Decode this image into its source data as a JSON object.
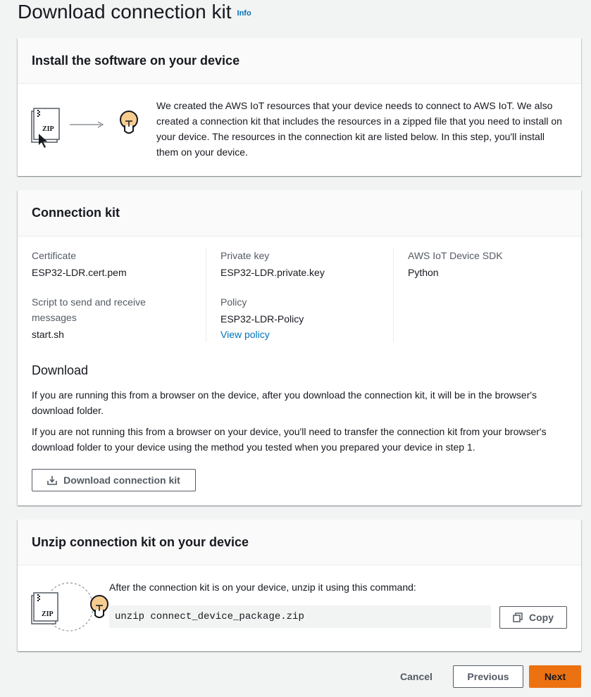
{
  "page": {
    "title": "Download connection kit",
    "info_label": "Info"
  },
  "install": {
    "header": "Install the software on your device",
    "description": "We created the AWS IoT resources that your device needs to connect to AWS IoT. We also created a connection kit that includes the resources in a zipped file that you need to install on your device. The resources in the connection kit are listed below. In this step, you'll install them on your device.",
    "zip_label": "ZIP"
  },
  "connection_kit": {
    "header": "Connection kit",
    "certificate_label": "Certificate",
    "certificate_value": "ESP32-LDR.cert.pem",
    "private_key_label": "Private key",
    "private_key_value": "ESP32-LDR.private.key",
    "sdk_label": "AWS IoT Device SDK",
    "sdk_value": "Python",
    "script_label": "Script to send and receive messages",
    "script_value": "start.sh",
    "policy_label": "Policy",
    "policy_value": "ESP32-LDR-Policy",
    "view_policy_link": "View policy",
    "download_heading": "Download",
    "download_text_1": "If you are running this from a browser on the device, after you download the connection kit, it will be in the browser's download folder.",
    "download_text_2": "If you are not running this from a browser on your device, you'll need to transfer the connection kit from your browser's download folder to your device using the method you tested when you prepared your device in step 1.",
    "download_button": "Download connection kit"
  },
  "unzip": {
    "header": "Unzip connection kit on your device",
    "instruction": "After the connection kit is on your device, unzip it using this command:",
    "command": "unzip connect_device_package.zip",
    "copy_button": "Copy",
    "zip_label": "ZIP"
  },
  "footer": {
    "cancel": "Cancel",
    "previous": "Previous",
    "next": "Next"
  },
  "colors": {
    "accent_link": "#0073bb",
    "primary_button": "#ec7211",
    "bulb_fill": "#f7cc8f"
  }
}
